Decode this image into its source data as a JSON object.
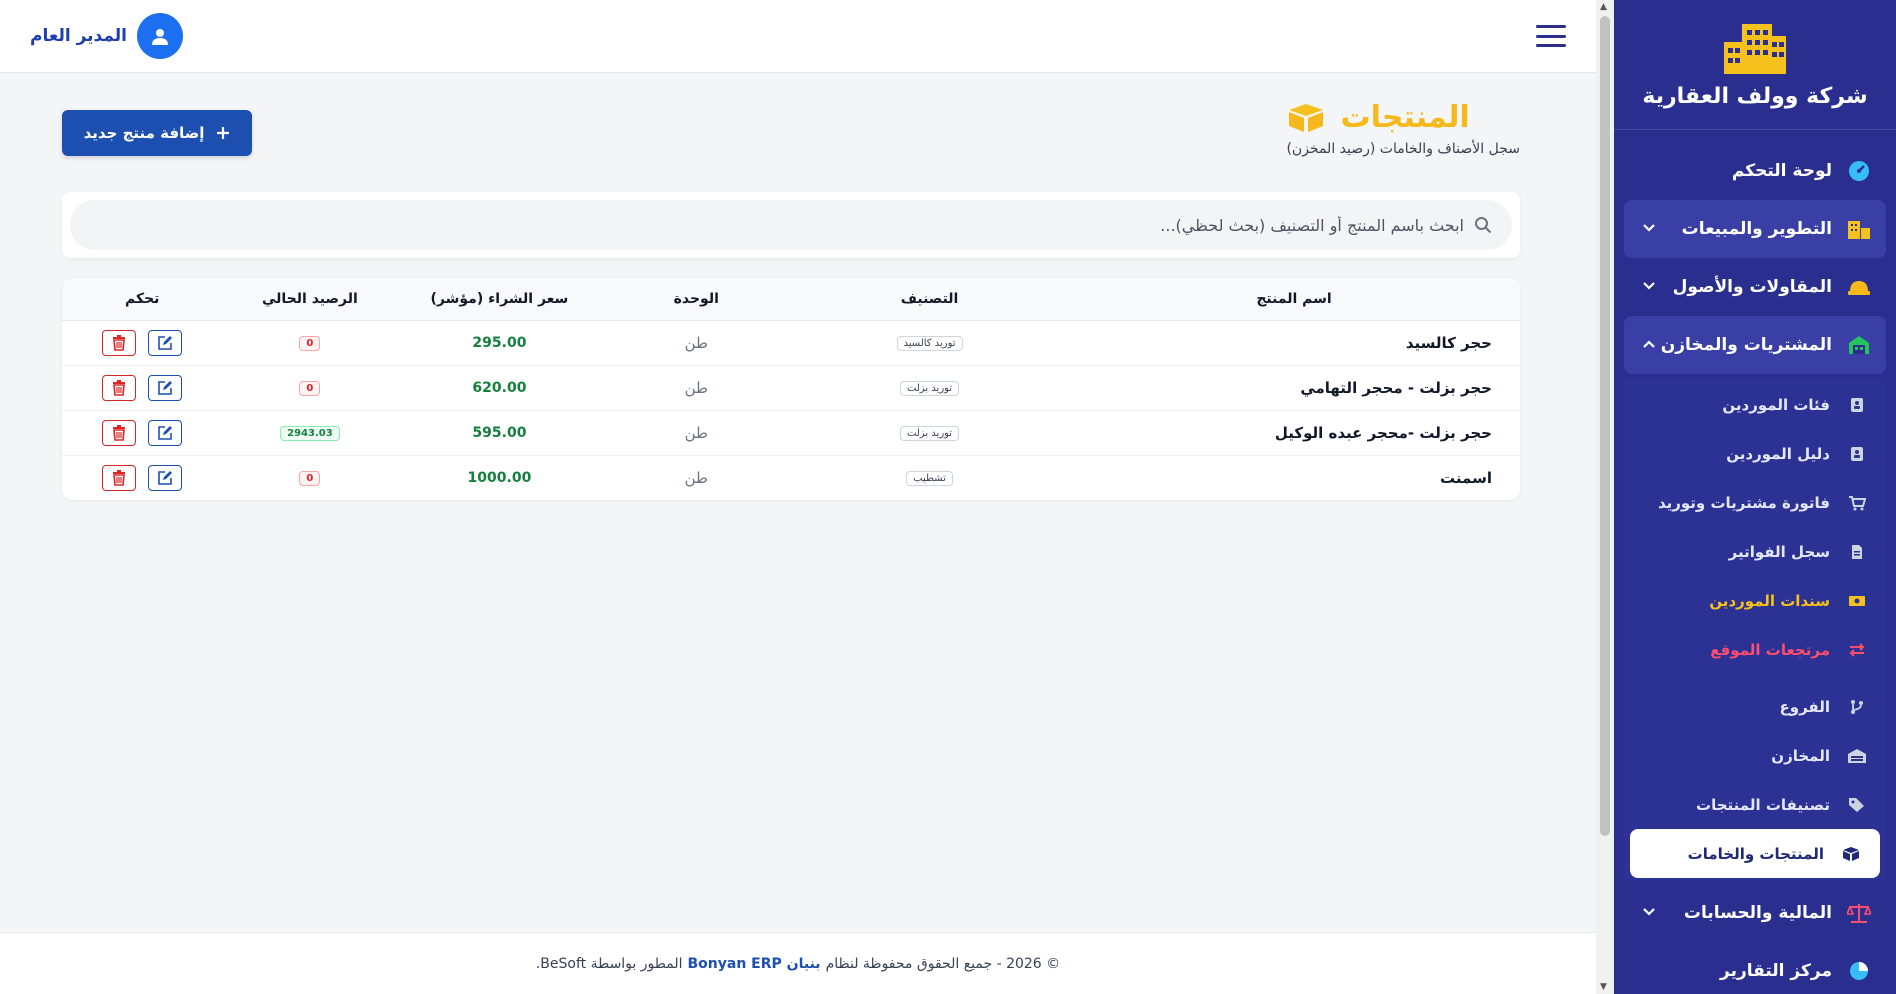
{
  "app": {
    "company_name": "شركة وولف العقارية"
  },
  "sidebar": {
    "items": [
      {
        "label": "لوحة التحكم",
        "icon": "dashboard-icon"
      },
      {
        "label": "التطوير والمبيعات",
        "icon": "buildings-icon"
      },
      {
        "label": "المقاولات والأصول",
        "icon": "helmet-icon"
      },
      {
        "label": "المشتريات والمخازن",
        "icon": "warehouse-icon"
      },
      {
        "label": "المالية والحسابات",
        "icon": "scale-icon"
      },
      {
        "label": "مركز التقارير",
        "icon": "pie-chart-icon"
      }
    ],
    "sub_items": [
      {
        "label": "فئات الموردين",
        "icon": "address-book-icon"
      },
      {
        "label": "دليل الموردين",
        "icon": "address-book-icon"
      },
      {
        "label": "فاتورة مشتريات وتوريد",
        "icon": "cart-icon"
      },
      {
        "label": "سجل الفواتير",
        "icon": "file-icon"
      },
      {
        "label": "سندات الموردين",
        "icon": "money-icon"
      },
      {
        "label": "مرتجعات الموقع",
        "icon": "exchange-icon"
      },
      {
        "label": "الفروع",
        "icon": "branch-icon"
      },
      {
        "label": "المخازن",
        "icon": "warehouse-icon"
      },
      {
        "label": "تصنيفات المنتجات",
        "icon": "tags-icon"
      },
      {
        "label": "المنتجات والخامات",
        "icon": "boxes-icon"
      }
    ]
  },
  "header": {
    "user_name": "المدير العام"
  },
  "page": {
    "title": "المنتجات",
    "subtitle": "سجل الأصناف والخامات (رصيد المخزن)",
    "add_button": "إضافة منتج جديد",
    "search_placeholder": "ابحث باسم المنتج أو التصنيف (بحث لحظي)..."
  },
  "table": {
    "columns": [
      "اسم المنتج",
      "التصنيف",
      "الوحدة",
      "سعر الشراء (مؤشر)",
      "الرصيد الحالي",
      "تحكم"
    ],
    "rows": [
      {
        "name": "حجر كالسيد",
        "category": "توريد كالسيد",
        "unit": "طن",
        "price": "295.00",
        "balance": "0"
      },
      {
        "name": "حجر بزلت - محجر التهامي",
        "category": "توريد بزلت",
        "unit": "طن",
        "price": "620.00",
        "balance": "0"
      },
      {
        "name": "حجر بزلت -محجر عبده الوكيل",
        "category": "توريد بزلت",
        "unit": "طن",
        "price": "595.00",
        "balance": "2943.03"
      },
      {
        "name": "اسمنت",
        "category": "تشطيب",
        "unit": "طن",
        "price": "1000.00",
        "balance": "0"
      }
    ]
  },
  "footer": {
    "prefix": "© 2026 - جميع الحقوق محفوظة لنظام",
    "brand": "بنيان Bonyan ERP",
    "suffix": "المطور بواسطة BeSoft."
  },
  "colors": {
    "sidebar": "#2a2f8f",
    "accent": "#f6b91c",
    "primary": "#1d4fb0"
  }
}
